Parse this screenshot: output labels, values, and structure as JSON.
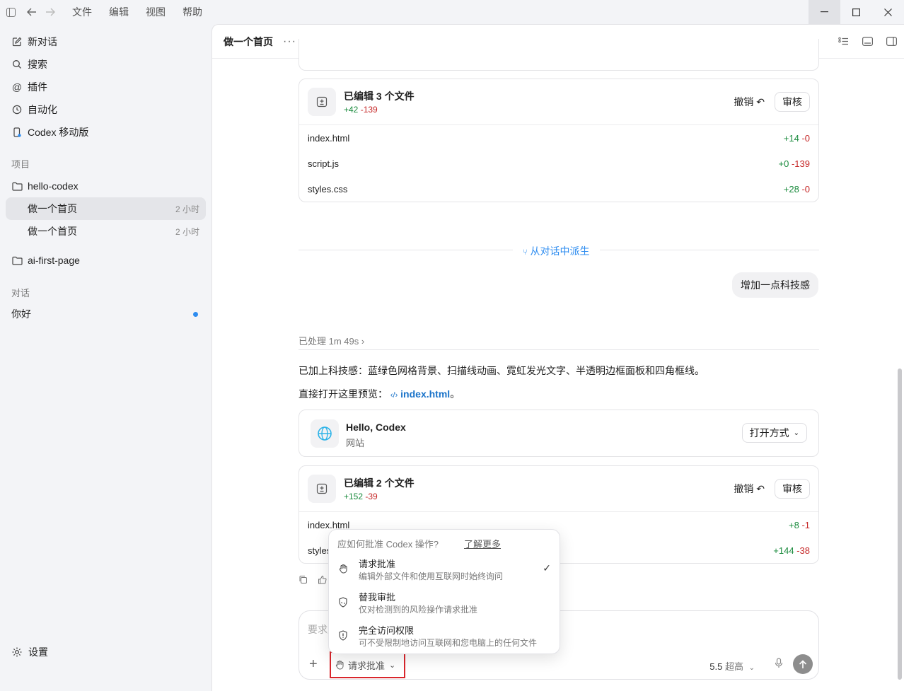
{
  "titlebar": {
    "menus": [
      "文件",
      "编辑",
      "视图",
      "帮助"
    ]
  },
  "sidebar": {
    "new_chat": "新对话",
    "search": "搜索",
    "plugins": "插件",
    "automation": "自动化",
    "mobile": "Codex 移动版",
    "projects_label": "项目",
    "project1": "hello-codex",
    "thread1": {
      "title": "做一个首页",
      "time": "2 小时"
    },
    "thread2": {
      "title": "做一个首页",
      "time": "2 小时"
    },
    "project2": "ai-first-page",
    "chats_label": "对话",
    "chat1": "你好",
    "settings": "设置"
  },
  "header": {
    "title": "做一个首页",
    "more": "···"
  },
  "card1": {
    "title": "已编辑 3 个文件",
    "plus": "+42",
    "minus": "-139",
    "undo": "撤销",
    "review": "审核",
    "files": [
      {
        "name": "index.html",
        "plus": "+14",
        "minus": "-0"
      },
      {
        "name": "script.js",
        "plus": "+0",
        "minus": "-139"
      },
      {
        "name": "styles.css",
        "plus": "+28",
        "minus": "-0"
      }
    ]
  },
  "fork": "从对话中派生",
  "user_message": "增加一点科技感",
  "processed": "已处理 1m 49s",
  "reply": {
    "line1": "已加上科技感：蓝绿色网格背景、扫描线动画、霓虹发光文字、半透明边框面板和四角框线。",
    "line2_prefix": "直接打开这里预览：",
    "line2_link": "index.html",
    "line2_suffix": "。"
  },
  "site_card": {
    "title": "Hello, Codex",
    "subtitle": "网站",
    "open": "打开方式"
  },
  "card2": {
    "title": "已编辑 2 个文件",
    "plus": "+152",
    "minus": "-39",
    "undo": "撤销",
    "review": "审核",
    "files": [
      {
        "name": "index.html",
        "plus": "+8",
        "minus": "-1"
      },
      {
        "name": "styles.css",
        "plus": "+144",
        "minus": "-38"
      }
    ]
  },
  "popup": {
    "heading": "应如何批准 Codex 操作?",
    "learn_more": "了解更多",
    "options": [
      {
        "title": "请求批准",
        "desc": "编辑外部文件和使用互联网时始终询问"
      },
      {
        "title": "替我审批",
        "desc": "仅对检测到的风险操作请求批准"
      },
      {
        "title": "完全访问权限",
        "desc": "可不受限制地访问互联网和您电脑上的任何文件"
      }
    ]
  },
  "composer": {
    "placeholder": "要求后续更改",
    "approval": "请求批准",
    "model": "5.5",
    "effort": "超高"
  },
  "colors": {
    "accent": "#2d8cf0",
    "plus": "#1a8b3d",
    "minus": "#c62828",
    "highlight": "#d9262c"
  }
}
